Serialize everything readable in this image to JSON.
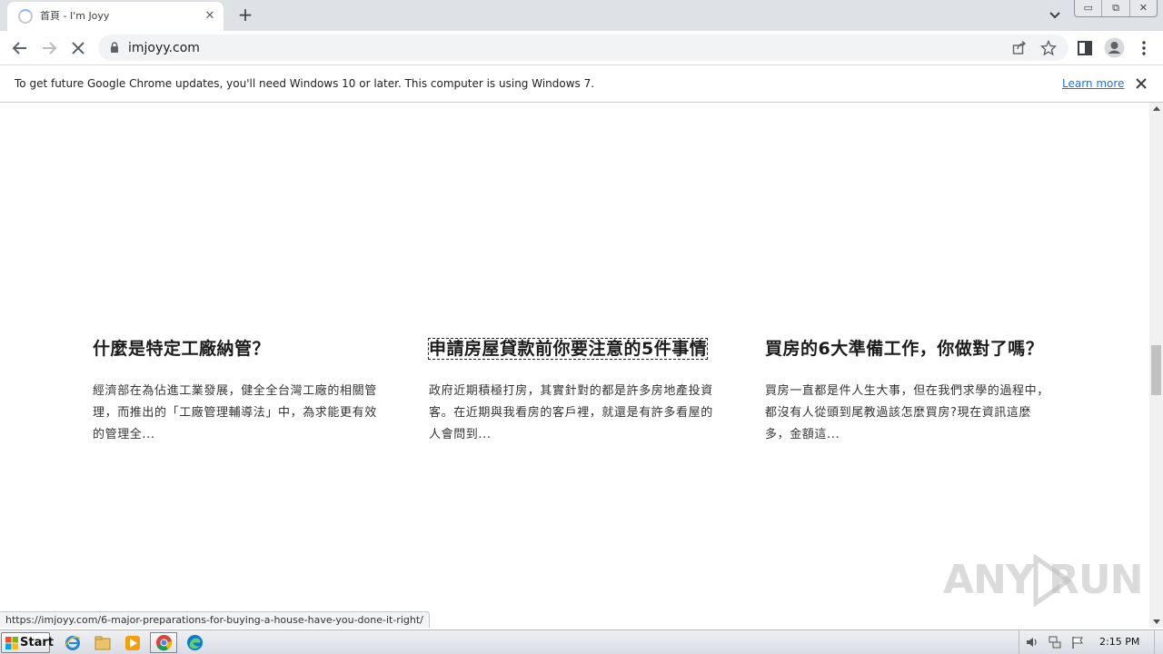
{
  "browser": {
    "tab": {
      "title": "首頁 - I'm Joyy",
      "close": "✕"
    },
    "new_tab": "+",
    "window_buttons": {
      "minimize": "▭",
      "restore": "⧉",
      "close": "✕"
    },
    "address": "imjoyy.com"
  },
  "infobar": {
    "message": "To get future Google Chrome updates, you'll need Windows 10 or later. This computer is using Windows 7.",
    "learn_more": "Learn more"
  },
  "articles": [
    {
      "title": "什麼是特定工廠納管？",
      "excerpt": "經濟部在為佔進工業發展，健全全台灣工廠的相關管理，而推出的「工廠管理輔導法」中，為求能更有效的管理全...",
      "focused": false
    },
    {
      "title": "申請房屋貸款前你要注意的5件事情",
      "excerpt": "政府近期積極打房，其實針對的都是許多房地產投資客。在近期與我看房的客戶裡，就還是有許多看屋的人會問到...",
      "focused": true
    },
    {
      "title": "買房的6大準備工作，你做對了嗎？",
      "excerpt": "買房一直都是件人生大事，但在我們求學的過程中，都沒有人從頭到尾教過該怎麼買房?現在資訊這麼多，金額這...",
      "focused": false
    }
  ],
  "status_url": "https://imjoyy.com/6-major-preparations-for-buying-a-house-have-you-done-it-right/",
  "watermark": {
    "left": "ANY",
    "right": "RUN"
  },
  "taskbar": {
    "start_label": "Start",
    "clock": "2:15 PM"
  },
  "colors": {
    "tabstrip": "#dee1e6",
    "link": "#1a73e8",
    "omnibox": "#f1f3f4"
  }
}
